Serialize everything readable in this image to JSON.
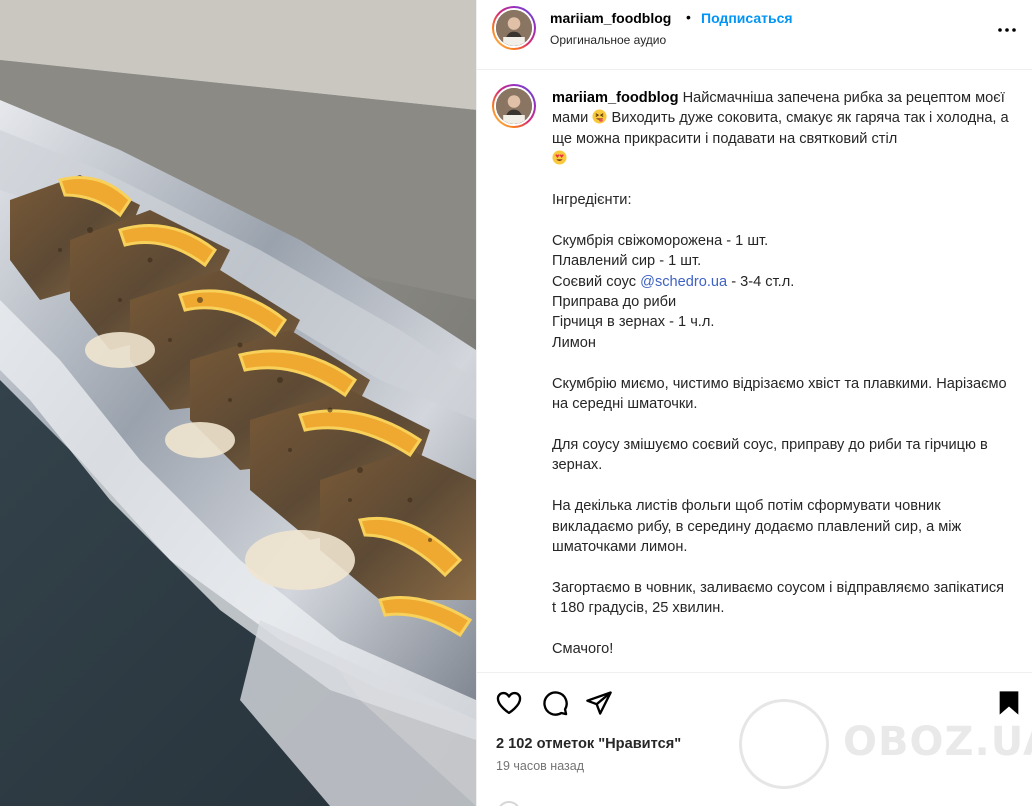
{
  "post": {
    "username": "mariiam_foodblog",
    "separator": "•",
    "follow_label": "Подписаться",
    "audio_label": "Оригинальное аудио",
    "more_icon": "more-horizontal-icon"
  },
  "caption": {
    "username": "mariiam_foodblog",
    "intro_1": "Найсмачніша запечена рибка за рецептом моєї мами",
    "intro_2": " Виходить дуже соковита, смакує як гаряча так і холодна, а ще можна прикрасити і подавати на святковий стіл",
    "emoji_1": "squinting-face-with-tongue",
    "emoji_2": "smiling-face-with-heart-eyes",
    "ingredients_title": "Інгредієнти:",
    "ingredient_1": "Скумбрія свіжоморожена - 1 шт.",
    "ingredient_2": "Плавлений сир - 1 шт.",
    "ingredient_3_before": "Соєвий соус ",
    "ingredient_3_mention": "@schedro.ua",
    "ingredient_3_after": " - 3-4 ст.л.",
    "ingredient_4": "Приправа до риби",
    "ingredient_5": "Гірчиця в зернах - 1 ч.л.",
    "ingredient_6": "Лимон",
    "step_1": "Скумбрію миємо, чистимо відрізаємо хвіст та плавкими. Нарізаємо на середні шматочки.",
    "step_2": "Для соусу змішуємо соєвий соус, приправу до риби та гірчицю в зернах.",
    "step_3": "На декілька листів фольги щоб потім сформувати човник викладаємо рибу, в середину додаємо плавлений сир, а між шматочками лимон.",
    "step_4": "Загортаємо в човник, заливаємо соусом і відправляємо запікатися t 180 градусів, 25 хвилин.",
    "closing": "Смачого!"
  },
  "actions": {
    "like_icon": "heart-icon",
    "comment_icon": "comment-icon",
    "share_icon": "paper-plane-icon",
    "save_icon": "bookmark-icon",
    "likes_text": "2 102 отметок \"Нравится\"",
    "time_text": "19 часов назад"
  },
  "watermark": {
    "text": "OBOZ.UA"
  },
  "colors": {
    "link": "#0095f6",
    "mention": "#3f62c4",
    "text": "#262626",
    "muted": "#737373"
  }
}
